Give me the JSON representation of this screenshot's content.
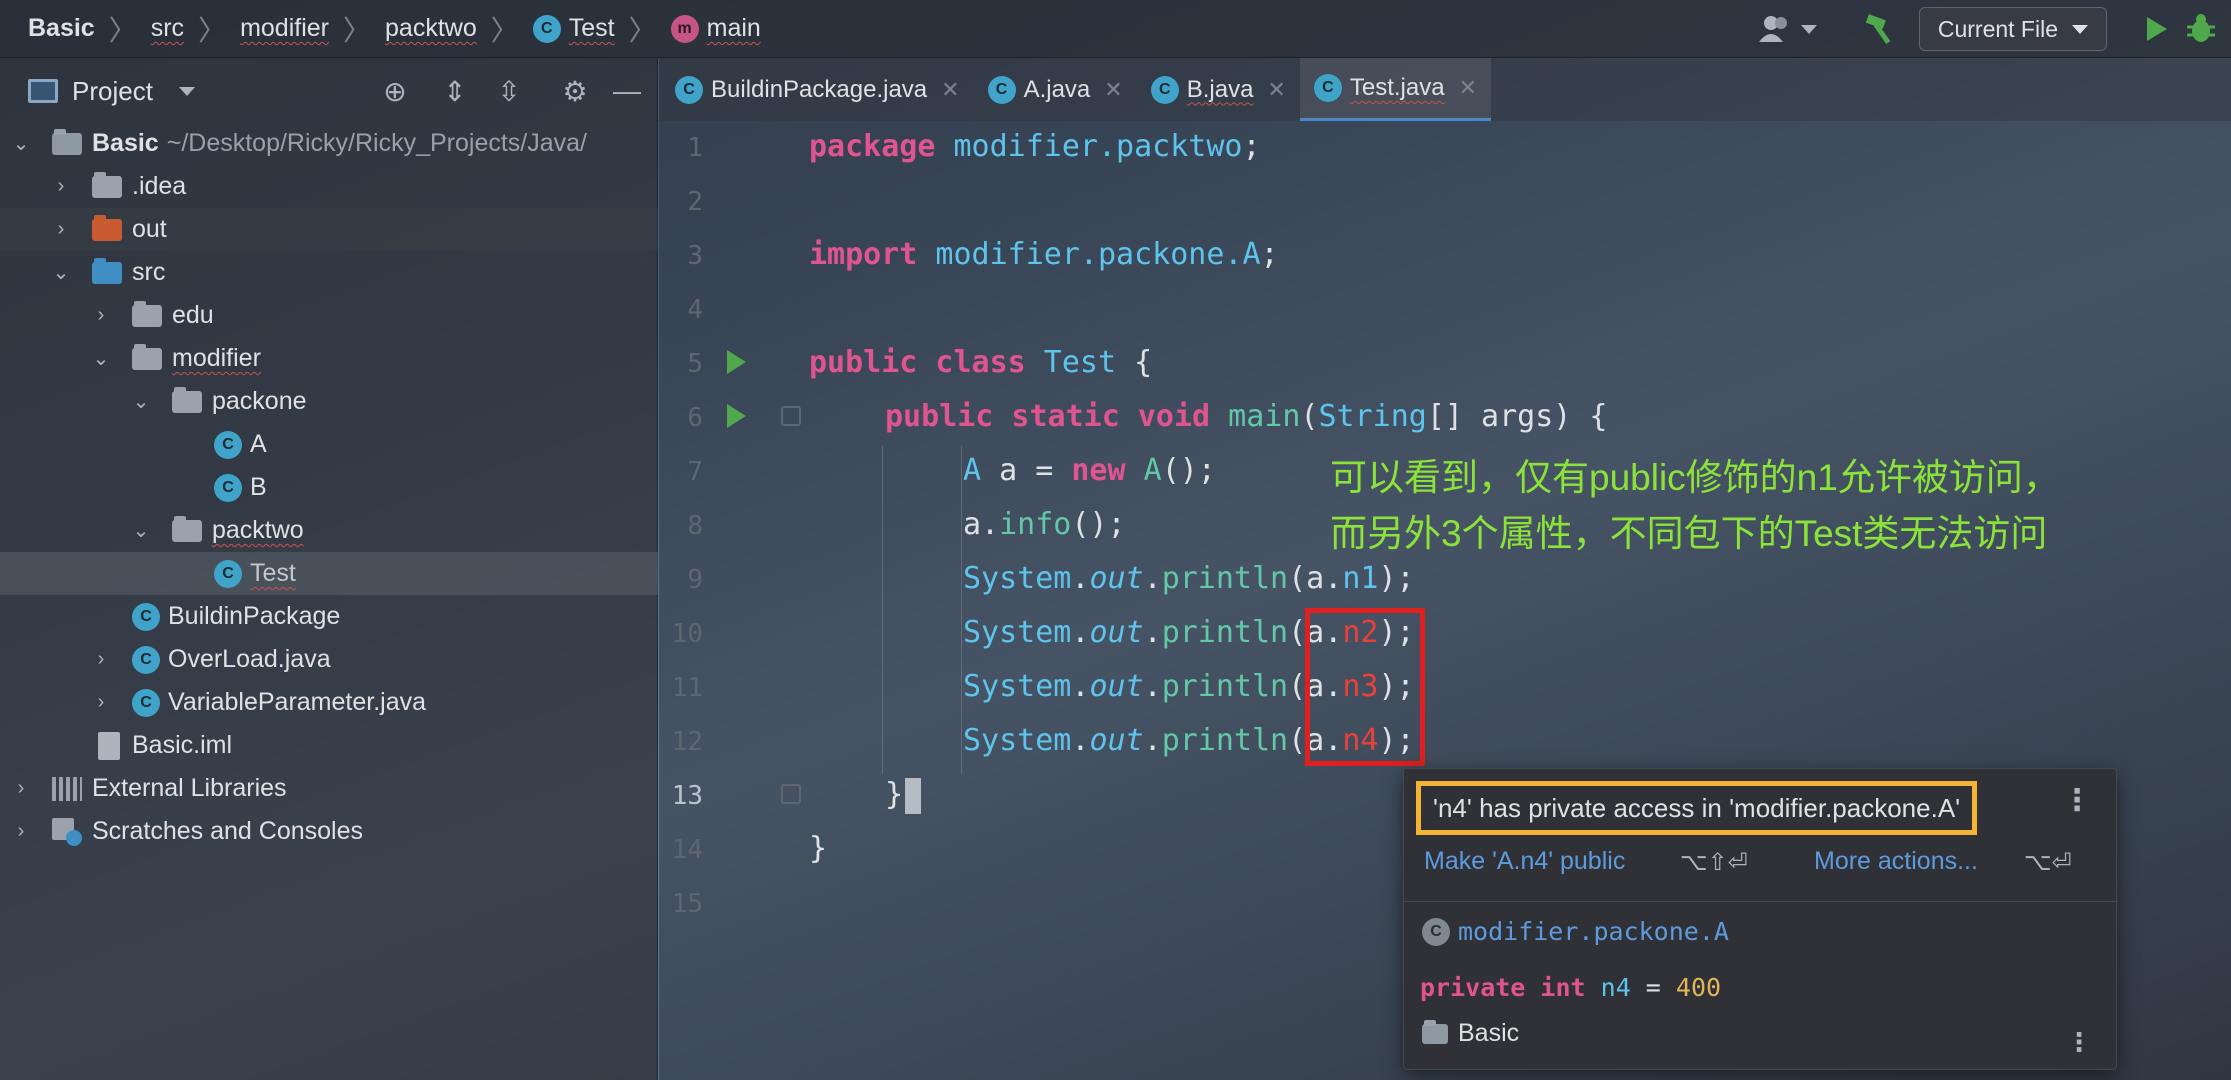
{
  "breadcrumb": {
    "project": "Basic",
    "items": [
      "src",
      "modifier",
      "packtwo",
      "Test",
      "main"
    ],
    "class_icon": "C",
    "method_icon": "m"
  },
  "toolbar": {
    "run_config": "Current File",
    "icons": [
      "user-icon",
      "hammer-icon",
      "run-icon",
      "debug-icon"
    ]
  },
  "project_pane": {
    "title": "Project",
    "tree": [
      {
        "label": "Basic",
        "hint": "~/Desktop/Ricky/Ricky_Projects/Java/",
        "icon": "module-folder"
      },
      {
        "label": ".idea",
        "icon": "folder"
      },
      {
        "label": "out",
        "icon": "excluded-folder"
      },
      {
        "label": "src",
        "icon": "source-folder"
      },
      {
        "label": "edu",
        "icon": "package"
      },
      {
        "label": "modifier",
        "icon": "package"
      },
      {
        "label": "packone",
        "icon": "package"
      },
      {
        "label": "A",
        "icon": "class"
      },
      {
        "label": "B",
        "icon": "class"
      },
      {
        "label": "packtwo",
        "icon": "package"
      },
      {
        "label": "Test",
        "icon": "class-runnable"
      },
      {
        "label": "BuildinPackage",
        "icon": "class-runnable"
      },
      {
        "label": "OverLoad.java",
        "icon": "class-runnable"
      },
      {
        "label": "VariableParameter.java",
        "icon": "class-runnable"
      },
      {
        "label": "Basic.iml",
        "icon": "iml-file"
      },
      {
        "label": "External Libraries",
        "icon": "libraries"
      },
      {
        "label": "Scratches and Consoles",
        "icon": "scratches"
      }
    ]
  },
  "tabs": [
    {
      "label": "BuildinPackage.java",
      "active": false
    },
    {
      "label": "A.java",
      "active": false
    },
    {
      "label": "B.java",
      "active": false
    },
    {
      "label": "Test.java",
      "active": true
    }
  ],
  "editor": {
    "line_numbers": [
      "1",
      "2",
      "3",
      "4",
      "5",
      "6",
      "7",
      "8",
      "9",
      "10",
      "11",
      "12",
      "13",
      "14",
      "15"
    ],
    "current_line": "13",
    "code": {
      "l1_kw": "package",
      "l1_pkg": " modifier.packtwo",
      "l1_end": ";",
      "l3_kw": "import",
      "l3_pkg": " modifier.packone.A",
      "l3_end": ";",
      "l5_kw": "public class",
      "l5_cls": " Test",
      "l5_end": " {",
      "l6_kw": "public static void",
      "l6_fn": " main",
      "l6_p1": "(",
      "l6_type": "String",
      "l6_p2": "[] args) {",
      "l7_cls": "A",
      "l7_mid": " a = ",
      "l7_kw": "new",
      "l7_fn": " A",
      "l7_end": "();",
      "l8_a": "a.",
      "l8_fn": "info",
      "l8_end": "();",
      "sys": "System",
      "dot": ".",
      "out": "out",
      "println": "println",
      "open": "(a.",
      "n1": "n1",
      "n2": "n2",
      "n3": "n3",
      "n4": "n4",
      "close": ");",
      "l13": "}",
      "l14": "}"
    }
  },
  "annotation": {
    "line1": "可以看到，仅有public修饰的n1允许被访问，",
    "line2": "而另外3个属性，不同包下的Test类无法访问"
  },
  "popup": {
    "message": "'n4' has private access in 'modifier.packone.A'",
    "fix_action": "Make 'A.n4' public",
    "fix_shortcut": "⌥⇧⏎",
    "more_action": "More actions...",
    "more_shortcut": "⌥⏎",
    "decl_class": "modifier.packone.A",
    "decl_kw1": "private",
    "decl_kw2": "int",
    "decl_name": "n4",
    "decl_eq": " = ",
    "decl_value": "400",
    "module": "Basic"
  },
  "colors": {
    "annotation": "#8be33a",
    "error_red": "#e8413c",
    "highlight_box": "#f5b335",
    "red_box": "#e01f1f"
  }
}
